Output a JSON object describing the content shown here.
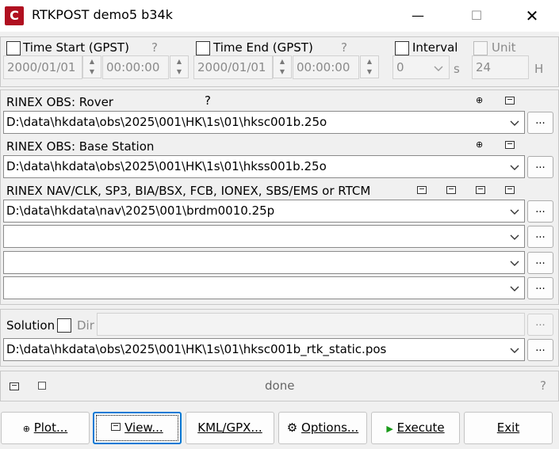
{
  "window": {
    "title": "RTKPOST demo5 b34k",
    "icon_letter": "C",
    "minimize": "—",
    "maximize": "☐",
    "close": "✕"
  },
  "time": {
    "start_label": "Time Start (GPST)",
    "start_help": "?",
    "start_date": "2000/01/01",
    "start_time": "00:00:00",
    "end_label": "Time End (GPST)",
    "end_help": "?",
    "end_date": "2000/01/01",
    "end_time": "00:00:00",
    "interval_label": "Interval",
    "interval_value": "0",
    "interval_unit": "s",
    "unit_label": "Unit",
    "unit_value": "24",
    "unit_unit": "H"
  },
  "inputs": {
    "rover_label": "RINEX OBS: Rover",
    "rover_help": "?",
    "rover_path": "D:\\data\\hkdata\\obs\\2025\\001\\HK\\1s\\01\\hksc001b.25o",
    "base_label": "RINEX OBS: Base Station",
    "base_path": "D:\\data\\hkdata\\obs\\2025\\001\\HK\\1s\\01\\hkss001b.25o",
    "nav_label": "RINEX NAV/CLK, SP3, BIA/BSX, FCB, IONEX, SBS/EMS  or RTCM",
    "nav_path": "D:\\data\\hkdata\\nav\\2025\\001\\brdm0010.25p",
    "extra1": "",
    "extra2": "",
    "extra3": "",
    "browse": "..."
  },
  "solution": {
    "label": "Solution",
    "dir_label": "Dir",
    "dir_value": "",
    "path": "D:\\data\\hkdata\\obs\\2025\\001\\HK\\1s\\01\\hksc001b_rtk_static.pos",
    "browse": "..."
  },
  "status": {
    "text": "done",
    "help": "?"
  },
  "buttons": {
    "plot": "Plot...",
    "view": "View...",
    "kml": "KML/GPX...",
    "options": "Options...",
    "execute": "Execute",
    "exit": "Exit"
  }
}
